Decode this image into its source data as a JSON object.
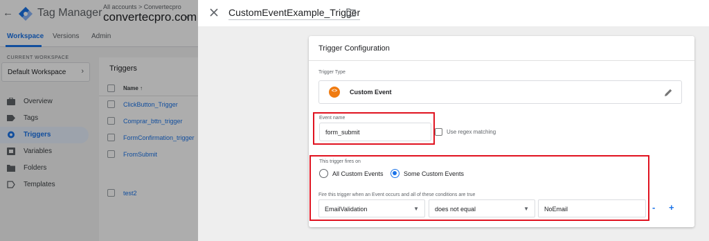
{
  "app": {
    "title": "Tag Manager",
    "account_crumb": "All accounts > Convertecpro",
    "container_name": "convertecpro.com"
  },
  "tabs": [
    {
      "label": "Workspace",
      "active": true
    },
    {
      "label": "Versions",
      "active": false
    },
    {
      "label": "Admin",
      "active": false
    }
  ],
  "sidebar": {
    "workspace_label": "CURRENT WORKSPACE",
    "workspace_name": "Default Workspace",
    "items": [
      {
        "label": "Overview",
        "icon": "briefcase-icon"
      },
      {
        "label": "Tags",
        "icon": "tag-icon"
      },
      {
        "label": "Triggers",
        "icon": "trigger-icon",
        "active": true
      },
      {
        "label": "Variables",
        "icon": "variables-icon"
      },
      {
        "label": "Folders",
        "icon": "folder-icon"
      },
      {
        "label": "Templates",
        "icon": "template-icon"
      }
    ]
  },
  "trigger_list": {
    "title": "Triggers",
    "column_name": "Name ↑",
    "rows": [
      "ClickButton_Trigger",
      "Comprar_bttn_trigger",
      "FormConfirmation_trigger",
      "FromSubmit",
      "test2"
    ]
  },
  "editor": {
    "trigger_name": "CustomEventExample_Trigger",
    "card_title": "Trigger Configuration",
    "trigger_type_label": "Trigger Type",
    "trigger_type": "Custom Event",
    "event_name_label": "Event name",
    "event_name_value": "form_submit",
    "regex_label": "Use regex matching",
    "regex_checked": false,
    "fires_on_label": "This trigger fires on",
    "fires_on_options": [
      {
        "label": "All Custom Events",
        "selected": false
      },
      {
        "label": "Some Custom Events",
        "selected": true
      }
    ],
    "condition_label": "Fire this trigger when an Event occurs and all of these conditions are true",
    "condition": {
      "variable": "EmailValidation",
      "operator": "does not equal",
      "value": "NoEmail"
    },
    "remove_label": "-",
    "add_label": "+"
  },
  "colors": {
    "accent": "#1a73e8",
    "highlight_box": "#e0121f",
    "custom_event_icon": "#f07b10"
  }
}
